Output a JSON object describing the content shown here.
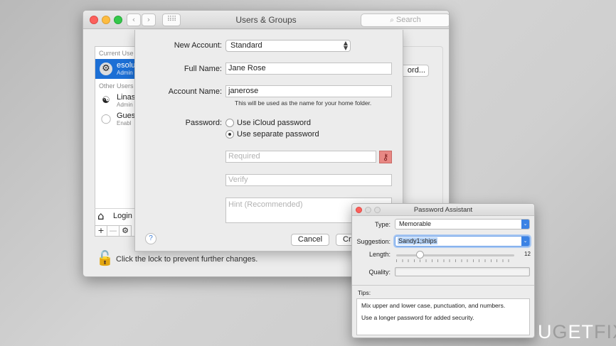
{
  "window": {
    "title": "Users & Groups",
    "search_placeholder": "Search",
    "search_icon": "magnifier-icon",
    "nav_back_glyph": "‹",
    "nav_forward_glyph": "›",
    "grid_glyph": "⠿⠿"
  },
  "sidebar": {
    "current_header": "Current Use",
    "other_header": "Other Users",
    "current_user": {
      "name": "esolu",
      "role": "Admin"
    },
    "other_users": [
      {
        "name": "Linas",
        "role": "Admin",
        "avatar_glyph": "☯"
      },
      {
        "name": "Gues",
        "role": "Enabl",
        "avatar_glyph": "◯"
      }
    ],
    "login_label": "Login",
    "add_glyph": "+",
    "remove_glyph": "—",
    "settings_glyph": "⚙"
  },
  "right_panel": {
    "password_button_label": "ord..."
  },
  "lock": {
    "text": "Click the lock to prevent further changes.",
    "icon_glyph": "🔓"
  },
  "sheet": {
    "new_account_label": "New Account:",
    "new_account_value": "Standard",
    "full_name_label": "Full Name:",
    "full_name_value": "Jane Rose",
    "account_name_label": "Account Name:",
    "account_name_value": "janerose",
    "account_name_note": "This will be used as the name for your home folder.",
    "password_label": "Password:",
    "radio_icloud": "Use iCloud password",
    "radio_separate": "Use separate password",
    "required_placeholder": "Required",
    "verify_placeholder": "Verify",
    "hint_placeholder": "Hint (Recommended)",
    "help_glyph": "?",
    "cancel_label": "Cancel",
    "create_label": "Cr",
    "key_glyph": "🔑"
  },
  "assistant": {
    "title": "Password Assistant",
    "type_label": "Type:",
    "type_value": "Memorable",
    "suggestion_label": "Suggestion:",
    "suggestion_value": "Sandy1;ships",
    "length_label": "Length:",
    "length_value": "12",
    "length_fraction": 0.2,
    "quality_label": "Quality:",
    "quality_fraction": 0.0,
    "tips_label": "Tips:",
    "tips": [
      "Mix upper and lower case, punctuation, and numbers.",
      "Use a longer password for added security."
    ]
  },
  "watermark": {
    "part1": "U",
    "part2": "G",
    "part3": "ET",
    "part4": "FIX"
  }
}
